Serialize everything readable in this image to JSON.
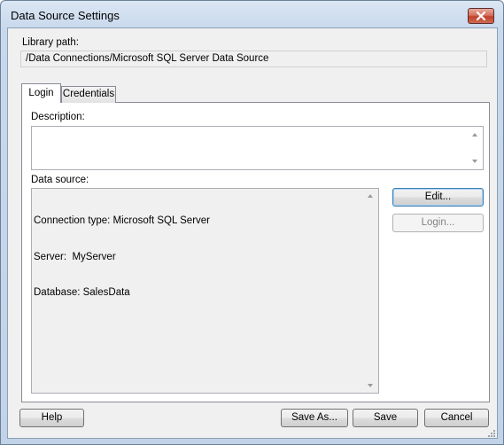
{
  "window": {
    "title": "Data Source Settings"
  },
  "library": {
    "label": "Library path:",
    "value": "/Data Connections/Microsoft SQL Server Data Source"
  },
  "tabs": [
    {
      "label": "Login",
      "selected": true
    },
    {
      "label": "Credentials",
      "selected": false
    }
  ],
  "login_tab": {
    "description_label": "Description:",
    "description_value": "",
    "data_source_label": "Data source:",
    "data_source_lines": [
      "Connection type: Microsoft SQL Server",
      "Server:  MyServer",
      "Database: SalesData"
    ],
    "edit_label": "Edit...",
    "login_label": "Login..."
  },
  "footer": {
    "help_label": "Help",
    "save_as_label": "Save As...",
    "save_label": "Save",
    "cancel_label": "Cancel"
  },
  "icons": {
    "close": "close-icon",
    "scroll_up": "scroll-up-arrow-icon",
    "scroll_down": "scroll-down-arrow-icon",
    "resize": "resize-grip-icon"
  },
  "colors": {
    "close_button": "#c1412b",
    "title_bar": "#c9d9ec",
    "dialog_bg": "#f0f0f0",
    "default_button_border": "#3c7fb1"
  }
}
